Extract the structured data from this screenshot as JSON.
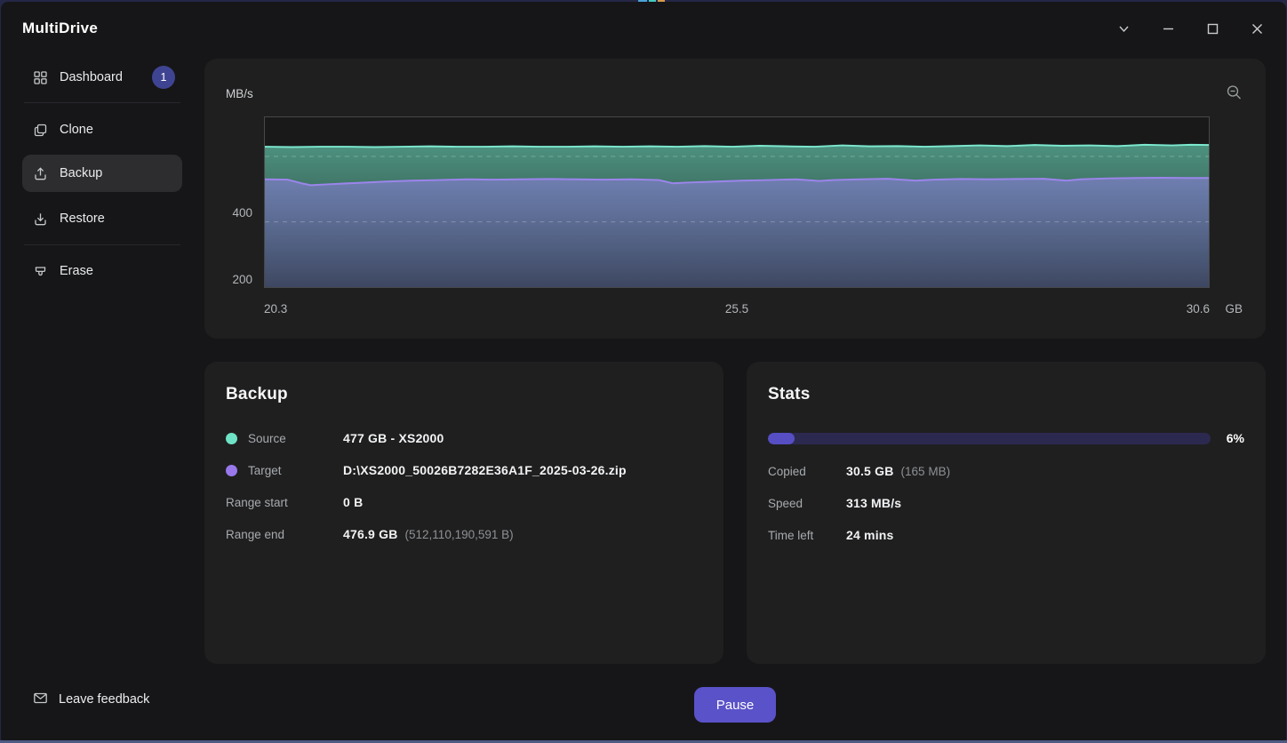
{
  "window": {
    "title": "MultiDrive",
    "controls": [
      {
        "name": "expand",
        "icon": "chevron-down-icon"
      },
      {
        "name": "minimize",
        "icon": "minimize-icon"
      },
      {
        "name": "maximize",
        "icon": "maximize-icon"
      },
      {
        "name": "close",
        "icon": "close-icon"
      }
    ]
  },
  "sidebar": {
    "items": [
      {
        "label": "Dashboard",
        "icon": "grid-icon",
        "badge": "1",
        "active": false
      },
      {
        "label": "Clone",
        "icon": "copy-icon",
        "active": false
      },
      {
        "label": "Backup",
        "icon": "upload-icon",
        "active": true
      },
      {
        "label": "Restore",
        "icon": "download-icon",
        "active": false
      },
      {
        "label": "Erase",
        "icon": "eraser-icon",
        "active": false
      }
    ]
  },
  "chart_panel": {
    "y_unit_label": "MB/s",
    "x_unit_label": "GB",
    "zoom_out_icon": "magnifier-minus-icon"
  },
  "chart_data": {
    "type": "area",
    "title": "",
    "xlabel": "GB",
    "ylabel": "MB/s",
    "xlim": [
      20.3,
      30.6
    ],
    "ylim": [
      0,
      520
    ],
    "x_ticks": [
      20.3,
      25.5,
      30.6
    ],
    "x_tick_labels": [
      "20.3",
      "25.5",
      "30.6"
    ],
    "y_ticks": [
      200,
      400
    ],
    "y_tick_labels": [
      "200",
      "400"
    ],
    "grid": "horizontal-dashed",
    "legend_position": "none",
    "series": [
      {
        "name": "source-read-speed",
        "color": "#7ce9cf",
        "fill_top": "rgba(109,220,190,0.62)",
        "fill_bottom": "rgba(109,220,190,0.12)",
        "x": [
          20.3,
          20.6,
          20.9,
          21.2,
          21.5,
          21.8,
          22.1,
          22.4,
          22.7,
          23.0,
          23.3,
          23.6,
          23.9,
          24.2,
          24.5,
          24.8,
          25.1,
          25.4,
          25.7,
          26.0,
          26.3,
          26.6,
          26.9,
          27.2,
          27.5,
          27.8,
          28.1,
          28.4,
          28.7,
          29.0,
          29.3,
          29.6,
          29.9,
          30.2,
          30.4,
          30.6
        ],
        "y": [
          430,
          429,
          430,
          430,
          429,
          430,
          431,
          430,
          430,
          431,
          430,
          430,
          431,
          430,
          431,
          430,
          432,
          430,
          433,
          431,
          430,
          434,
          431,
          432,
          430,
          432,
          434,
          432,
          435,
          433,
          434,
          432,
          436,
          434,
          436,
          435
        ]
      },
      {
        "name": "target-write-speed",
        "color": "#9c85ec",
        "fill_top": "rgba(122,127,193,0.80)",
        "fill_bottom": "rgba(88,93,148,0.50)",
        "x": [
          20.3,
          20.55,
          20.7,
          20.8,
          21.0,
          21.3,
          21.6,
          21.9,
          22.2,
          22.5,
          22.8,
          23.1,
          23.4,
          23.7,
          24.0,
          24.3,
          24.6,
          24.75,
          24.9,
          25.2,
          25.5,
          25.8,
          26.1,
          26.35,
          26.5,
          26.8,
          27.1,
          27.4,
          27.6,
          27.9,
          28.2,
          28.5,
          28.8,
          29.05,
          29.2,
          29.5,
          29.8,
          30.1,
          30.35,
          30.6
        ],
        "y": [
          330,
          329,
          318,
          312,
          315,
          319,
          323,
          326,
          328,
          330,
          329,
          330,
          331,
          330,
          329,
          330,
          328,
          318,
          320,
          323,
          326,
          328,
          330,
          325,
          328,
          330,
          332,
          326,
          329,
          331,
          330,
          331,
          332,
          326,
          330,
          333,
          334,
          335,
          334,
          334
        ]
      }
    ]
  },
  "backup_card": {
    "title": "Backup",
    "rows": [
      {
        "label": "Source",
        "dot_color": "#6fe3c5",
        "value": "477 GB - XS2000"
      },
      {
        "label": "Target",
        "dot_color": "#9878ea",
        "value": "D:\\XS2000_50026B7282E36A1F_2025-03-26.zip"
      },
      {
        "label": "Range start",
        "value": "0 B"
      },
      {
        "label": "Range end",
        "value": "476.9 GB",
        "value_secondary": "(512,110,190,591 B)"
      }
    ]
  },
  "stats_card": {
    "title": "Stats",
    "progress": {
      "percent": 6,
      "percent_label": "6%"
    },
    "rows": [
      {
        "label": "Copied",
        "value": "30.5 GB",
        "value_secondary": "(165 MB)"
      },
      {
        "label": "Speed",
        "value": "313 MB/s"
      },
      {
        "label": "Time left",
        "value": "24 mins"
      }
    ]
  },
  "footer": {
    "feedback_label": "Leave feedback",
    "pause_label": "Pause"
  },
  "colors": {
    "accent": "#5a52c8",
    "source_series": "#7ce9cf",
    "target_series": "#9c85ec",
    "progress_track": "#2c2950",
    "progress_fill": "#564ec2",
    "card_bg": "#1f1f20",
    "window_bg": "#161618"
  }
}
